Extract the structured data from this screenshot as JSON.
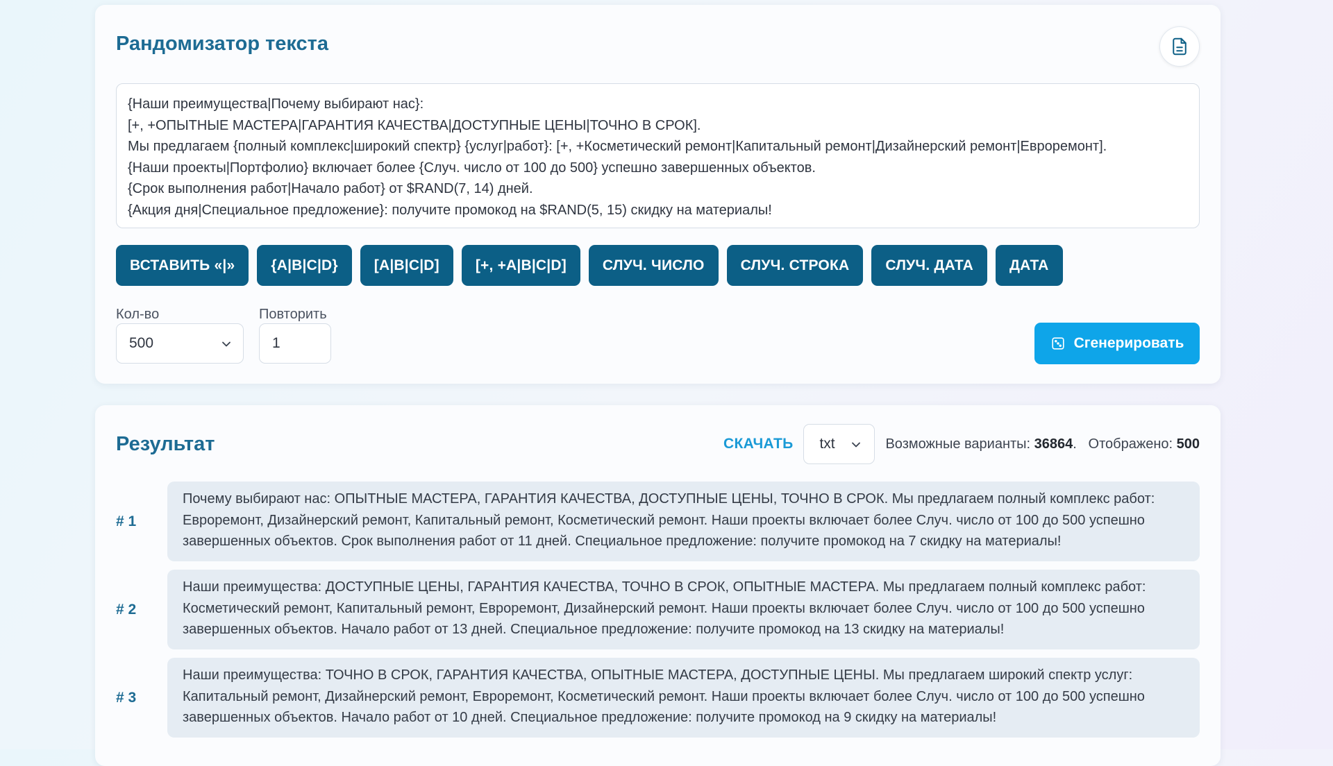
{
  "top": {
    "title": "Рандомизатор текста",
    "template_lines": [
      "{Наши преимущества|Почему выбирают нас}:",
      "[+, +ОПЫТНЫЕ МАСТЕРА|ГАРАНТИЯ КАЧЕСТВА|ДОСТУПНЫЕ ЦЕНЫ|ТОЧНО В СРОК].",
      "Мы предлагаем {полный комплекс|широкий спектр} {услуг|работ}: [+, +Косметический ремонт|Капитальный ремонт|Дизайнерский ремонт|Евроремонт].",
      "{Наши проекты|Портфолио} включает более {Случ. число от 100 до 500} успешно завершенных объектов.",
      "{Срок выполнения работ|Начало работ} от $RAND(7, 14) дней.",
      "{Акция дня|Специальное предложение}: получите промокод на $RAND(5, 15) скидку на материалы!"
    ],
    "buttons": [
      "ВСТАВИТЬ «|»",
      "{A|B|C|D}",
      "[A|B|C|D]",
      "[+, +A|B|C|D]",
      "СЛУЧ. ЧИСЛО",
      "СЛУЧ. СТРОКА",
      "СЛУЧ. ДАТА",
      "ДАТА"
    ],
    "count_label": "Кол-во",
    "count_value": "500",
    "repeat_label": "Повторить",
    "repeat_value": "1",
    "generate_label": "Сгенерировать"
  },
  "result": {
    "title": "Результат",
    "download_label": "СКАЧАТЬ",
    "format_value": "txt",
    "variants_label": "Возможные варианты:",
    "variants_value": "36864",
    "shown_label": "Отображено:",
    "shown_value": "500",
    "rows": [
      {
        "num": "# 1",
        "text": "Почему выбирают нас: ОПЫТНЫЕ МАСТЕРА, ГАРАНТИЯ КАЧЕСТВА, ДОСТУПНЫЕ ЦЕНЫ, ТОЧНО В СРОК. Мы предлагаем полный комплекс работ: Евроремонт, Дизайнерский ремонт, Капитальный ремонт, Косметический ремонт. Наши проекты включает более Случ. число от 100 до 500 успешно завершенных объектов. Срок выполнения работ от 11 дней. Специальное предложение: получите промокод на 7 скидку на материалы!"
      },
      {
        "num": "# 2",
        "text": "Наши преимущества: ДОСТУПНЫЕ ЦЕНЫ, ГАРАНТИЯ КАЧЕСТВА, ТОЧНО В СРОК, ОПЫТНЫЕ МАСТЕРА. Мы предлагаем полный комплекс работ: Косметический ремонт, Капитальный ремонт, Евроремонт, Дизайнерский ремонт. Наши проекты включает более Случ. число от 100 до 500 успешно завершенных объектов. Начало работ от 13 дней. Специальное предложение: получите промокод на 13 скидку на материалы!"
      },
      {
        "num": "# 3",
        "text": "Наши преимущества: ТОЧНО В СРОК, ГАРАНТИЯ КАЧЕСТВА, ОПЫТНЫЕ МАСТЕРА, ДОСТУПНЫЕ ЦЕНЫ. Мы предлагаем широкий спектр услуг: Капитальный ремонт, Дизайнерский ремонт, Евроремонт, Косметический ремонт. Наши проекты включает более Случ. число от 100 до 500 успешно завершенных объектов. Начало работ от 10 дней. Специальное предложение: получите промокод на 9 скидку на материалы!"
      }
    ]
  },
  "colors": {
    "accent_dark": "#0c5f86",
    "accent_bright": "#0ea5e9",
    "title_blue": "#1d6b93",
    "link_blue": "#1a9ad6"
  }
}
